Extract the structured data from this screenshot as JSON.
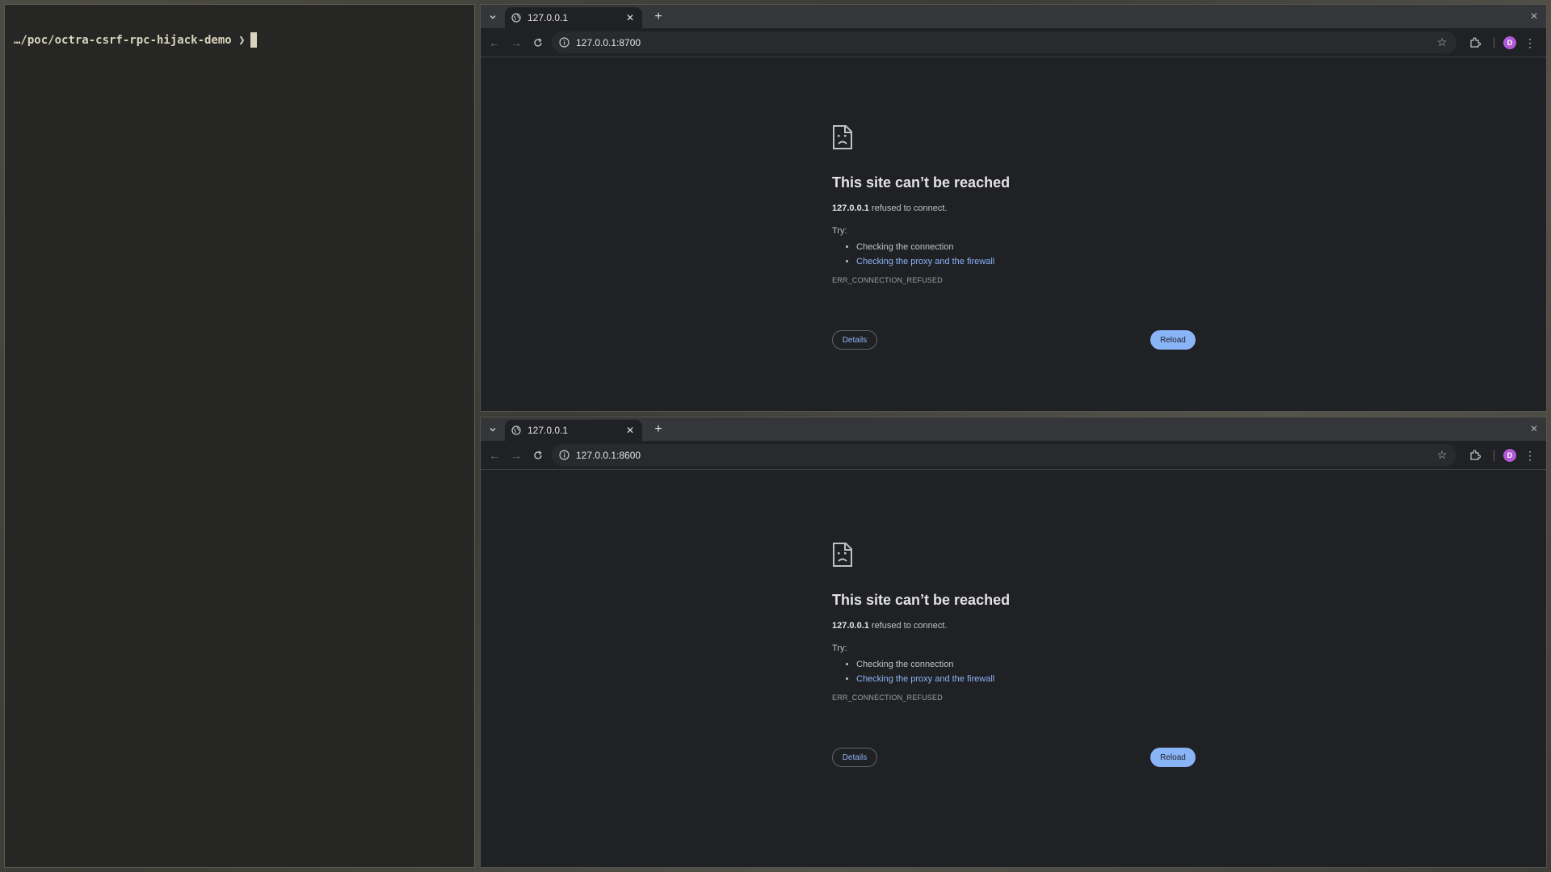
{
  "terminal": {
    "prompt": "…/poc/octra-csrf-rpc-hijack-demo ❯"
  },
  "browser_top": {
    "tab_title": "127.0.0.1",
    "url": "127.0.0.1:8700",
    "avatar_letter": "D",
    "error": {
      "title": "This site can’t be reached",
      "host": "127.0.0.1",
      "message": " refused to connect.",
      "try_label": "Try:",
      "suggestions": [
        "Checking the connection",
        "Checking the proxy and the firewall"
      ],
      "code": "ERR_CONNECTION_REFUSED",
      "details_label": "Details",
      "reload_label": "Reload"
    }
  },
  "browser_bottom": {
    "tab_title": "127.0.0.1",
    "url": "127.0.0.1:8600",
    "avatar_letter": "D",
    "error": {
      "title": "This site can’t be reached",
      "host": "127.0.0.1",
      "message": " refused to connect.",
      "try_label": "Try:",
      "suggestions": [
        "Checking the connection",
        "Checking the proxy and the firewall"
      ],
      "code": "ERR_CONNECTION_REFUSED",
      "details_label": "Details",
      "reload_label": "Reload"
    }
  },
  "colors": {
    "accent": "#8ab4f8",
    "avatar": "#b05ad8",
    "page_bg": "#202124",
    "terminal_bg": "#262624"
  }
}
